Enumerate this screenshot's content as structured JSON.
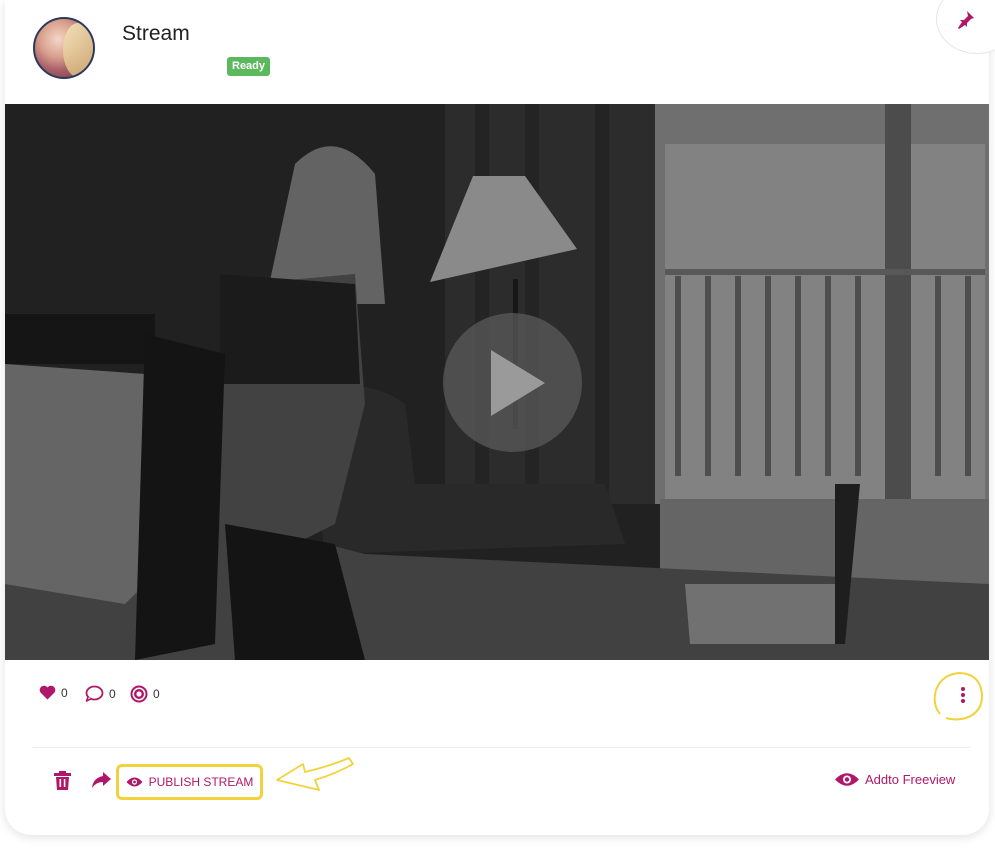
{
  "post": {
    "title": "Stream",
    "status_badge": "Ready",
    "colors": {
      "accent": "#b0176a",
      "badge": "#5cb85c",
      "highlight": "#f2d23c"
    }
  },
  "icons": {
    "avatar": "avatar-image",
    "pin": "pin-icon",
    "play": "play-icon",
    "like": "heart-icon",
    "comment": "comment-icon",
    "tip": "tip-icon",
    "more": "more-vertical-icon",
    "delete": "trash-icon",
    "share": "share-icon",
    "publish": "eye-icon",
    "freeview": "eye-icon"
  },
  "stats": {
    "likes": "0",
    "comments": "0",
    "tips": "0"
  },
  "actions": {
    "publish_label": "PUBLISH STREAM",
    "freeview_label": "Addto Freeview"
  }
}
